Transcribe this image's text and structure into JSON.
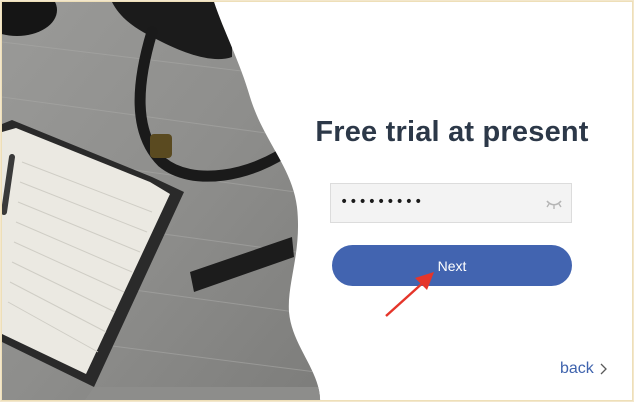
{
  "title": "Free trial at present",
  "password": {
    "masked_value": "•••••••••",
    "toggle_icon": "eye-closed-icon"
  },
  "next_button": {
    "label": "Next",
    "color": "#4264b0"
  },
  "back_link": {
    "label": "back",
    "icon": "chevron-right-icon"
  },
  "annotation": {
    "icon": "red-arrow-icon",
    "color": "#e5352a"
  }
}
